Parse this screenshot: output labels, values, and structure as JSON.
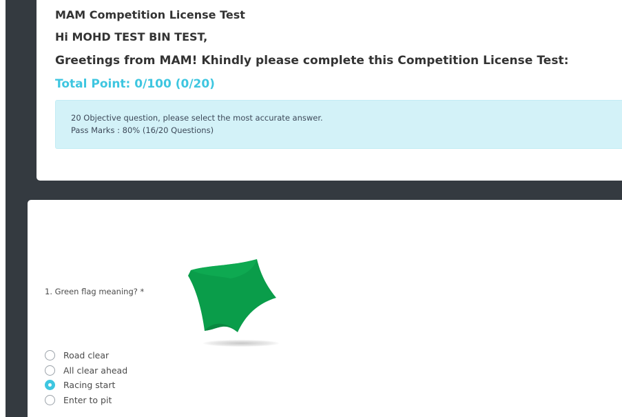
{
  "header": {
    "test_title": "MAM Competition License Test",
    "greeting": "Hi MOHD TEST BIN TEST,",
    "instruction": "Greetings from MAM! Khindly please complete this Competition License Test:",
    "total_point": "Total Point: 0/100 (0/20)",
    "accent_color": "#3ec6e0"
  },
  "info": {
    "line1": "20 Objective question, please select the most accurate answer.",
    "line2": "Pass Marks : 80% (16/20 Questions)"
  },
  "question": {
    "label": "1. Green flag meaning? *",
    "image_icon": "green-flag-icon",
    "flag_color": "#0a9d4a",
    "options": [
      {
        "label": "Road clear",
        "checked": false
      },
      {
        "label": "All clear ahead",
        "checked": false
      },
      {
        "label": "Racing start",
        "checked": true
      },
      {
        "label": "Enter to pit",
        "checked": false
      }
    ]
  }
}
